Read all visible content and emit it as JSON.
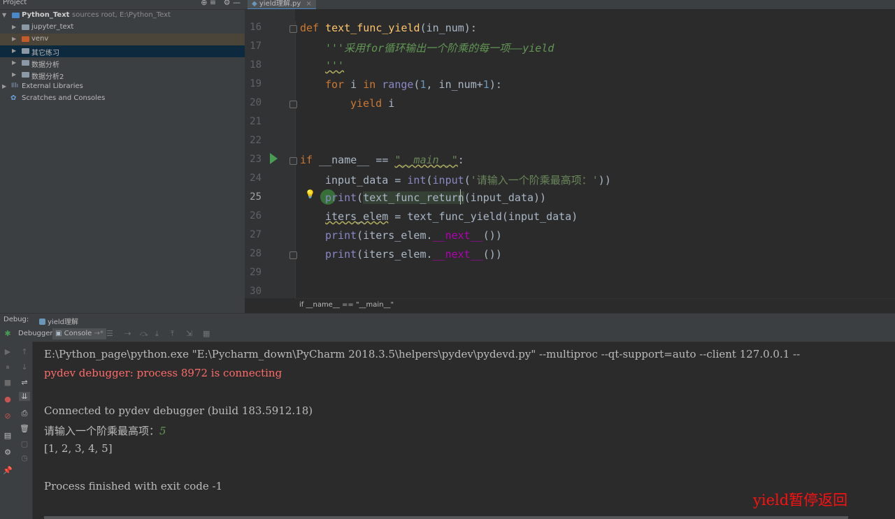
{
  "project": {
    "title": "Project",
    "tools": "⊕ ≡   ⚙ —",
    "tree": [
      {
        "label": "Python_Text",
        "sub": "sources root, E:\\Python_Text"
      },
      {
        "label": "jupyter_text"
      },
      {
        "label": "venv"
      },
      {
        "label": "其它练习"
      },
      {
        "label": "数据分析"
      },
      {
        "label": "数据分析2"
      },
      {
        "label": "External Libraries"
      },
      {
        "label": "Scratches and Consoles"
      }
    ]
  },
  "editor": {
    "tab": "yield理解.py",
    "tab_close": "×",
    "lines": [
      "16",
      "17",
      "18",
      "19",
      "20",
      "21",
      "22",
      "23",
      "24",
      "25",
      "26",
      "27",
      "28",
      "29",
      "30"
    ],
    "code": {
      "l16_kw": "def ",
      "l16_fn": "text_func_yield",
      "l16_rest": "(in_num):",
      "l17_doc": "'''采用for循环输出一个阶乘的每一项——yield",
      "l18_doc": "'''",
      "l19_for": "for ",
      "l19_i": "i ",
      "l19_in": "in ",
      "l19_range": "range",
      "l19_p1": "(",
      "l19_one": "1",
      "l19_mid": ", in_num+",
      "l19_one2": "1",
      "l19_end": "):",
      "l20_kw": "yield ",
      "l20_i": "i",
      "l23_if": "if ",
      "l23_name": "__name__ == ",
      "l23_str": "\"__main__\"",
      "l23_colon": ":",
      "l24_a": "input_data = ",
      "l24_int": "int",
      "l24_p": "(",
      "l24_input": "input",
      "l24_p2": "(",
      "l24_str": "'请输入一个阶乘最高项：'",
      "l24_end": "))",
      "l25_print": "print",
      "l25_p": "(",
      "l25_ref": "text_func_return",
      "l25_end": "(input_data))",
      "l26_var": "iters_elem",
      "l26_rest": " = text_func_yield(input_data)",
      "l27_print": "print",
      "l27_mid": "(iters_elem.",
      "l27_magic": "__next__",
      "l27_end": "())",
      "l28_print": "print",
      "l28_mid": "(iters_elem.",
      "l28_magic": "__next__",
      "l28_end": "())"
    },
    "breadcrumb": "if __name__ == \"__main__\""
  },
  "debug": {
    "label": "Debug:",
    "file": "yield理解",
    "tab_debugger": "Debugger",
    "tab_console": "Console",
    "tab_console_suffix": "→*"
  },
  "console": {
    "line1": "E:\\Python_page\\python.exe \"E:\\Pycharm_down\\PyCharm 2018.3.5\\helpers\\pydev\\pydevd.py\" --multiproc --qt-support=auto --client 127.0.0.1 --",
    "line2": "pydev debugger: process 8972 is connecting",
    "line3": "Connected to pydev debugger (build 183.5912.18)",
    "prompt": "请输入一个阶乘最高项：",
    "input_value": "5",
    "line5": "[1, 2, 3, 4, 5]",
    "line6": "Process finished with exit code -1"
  },
  "watermark": "yield暂停返回",
  "colors": {
    "keyword": "#cc7832",
    "function": "#ffc66d",
    "docstring": "#629755",
    "number": "#6897bb",
    "error": "#ff6b68",
    "watermark": "#ff1010"
  }
}
